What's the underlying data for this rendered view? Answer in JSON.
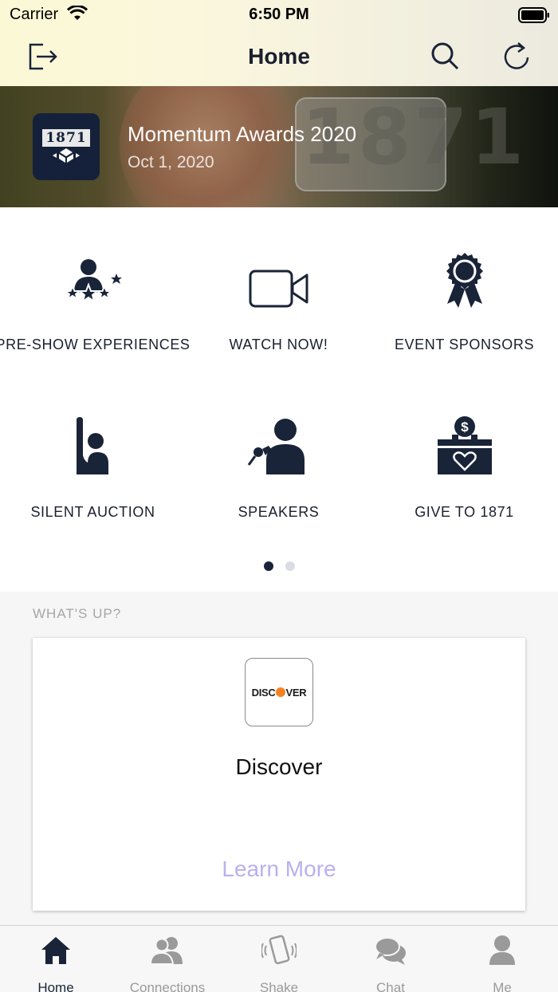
{
  "status_bar": {
    "carrier": "Carrier",
    "time": "6:50 PM"
  },
  "nav": {
    "title": "Home",
    "left_icon": "logout-icon",
    "right_icons": [
      "search-icon",
      "refresh-icon"
    ]
  },
  "banner": {
    "event_title": "Momentum Awards 2020",
    "event_date": "Oct 1, 2020",
    "logo_text": "1871"
  },
  "features": [
    {
      "label": "PRE-SHOW EXPERIENCES",
      "icon": "star-person-icon"
    },
    {
      "label": "WATCH NOW!",
      "icon": "video-camera-icon"
    },
    {
      "label": "EVENT SPONSORS",
      "icon": "award-ribbon-icon"
    },
    {
      "label": "SILENT AUCTION",
      "icon": "raised-hand-icon"
    },
    {
      "label": "SPEAKERS",
      "icon": "speaker-microphone-icon"
    },
    {
      "label": "GIVE TO 1871",
      "icon": "donation-box-icon"
    }
  ],
  "pager": {
    "pages": 2,
    "current": 1
  },
  "whats_up": {
    "heading": "WHAT'S UP?",
    "card": {
      "logo_text": "DISCOVER",
      "title": "Discover",
      "link": "Learn More"
    }
  },
  "tabs": [
    {
      "label": "Home",
      "icon": "home-icon",
      "active": true
    },
    {
      "label": "Connections",
      "icon": "people-icon",
      "active": false
    },
    {
      "label": "Shake",
      "icon": "phone-shake-icon",
      "active": false
    },
    {
      "label": "Chat",
      "icon": "chat-bubbles-icon",
      "active": false
    },
    {
      "label": "Me",
      "icon": "person-icon",
      "active": false
    }
  ],
  "colors": {
    "navy": "#1a2438",
    "link": "#b9b0ee",
    "inactive_tab": "#9a9a9a"
  }
}
